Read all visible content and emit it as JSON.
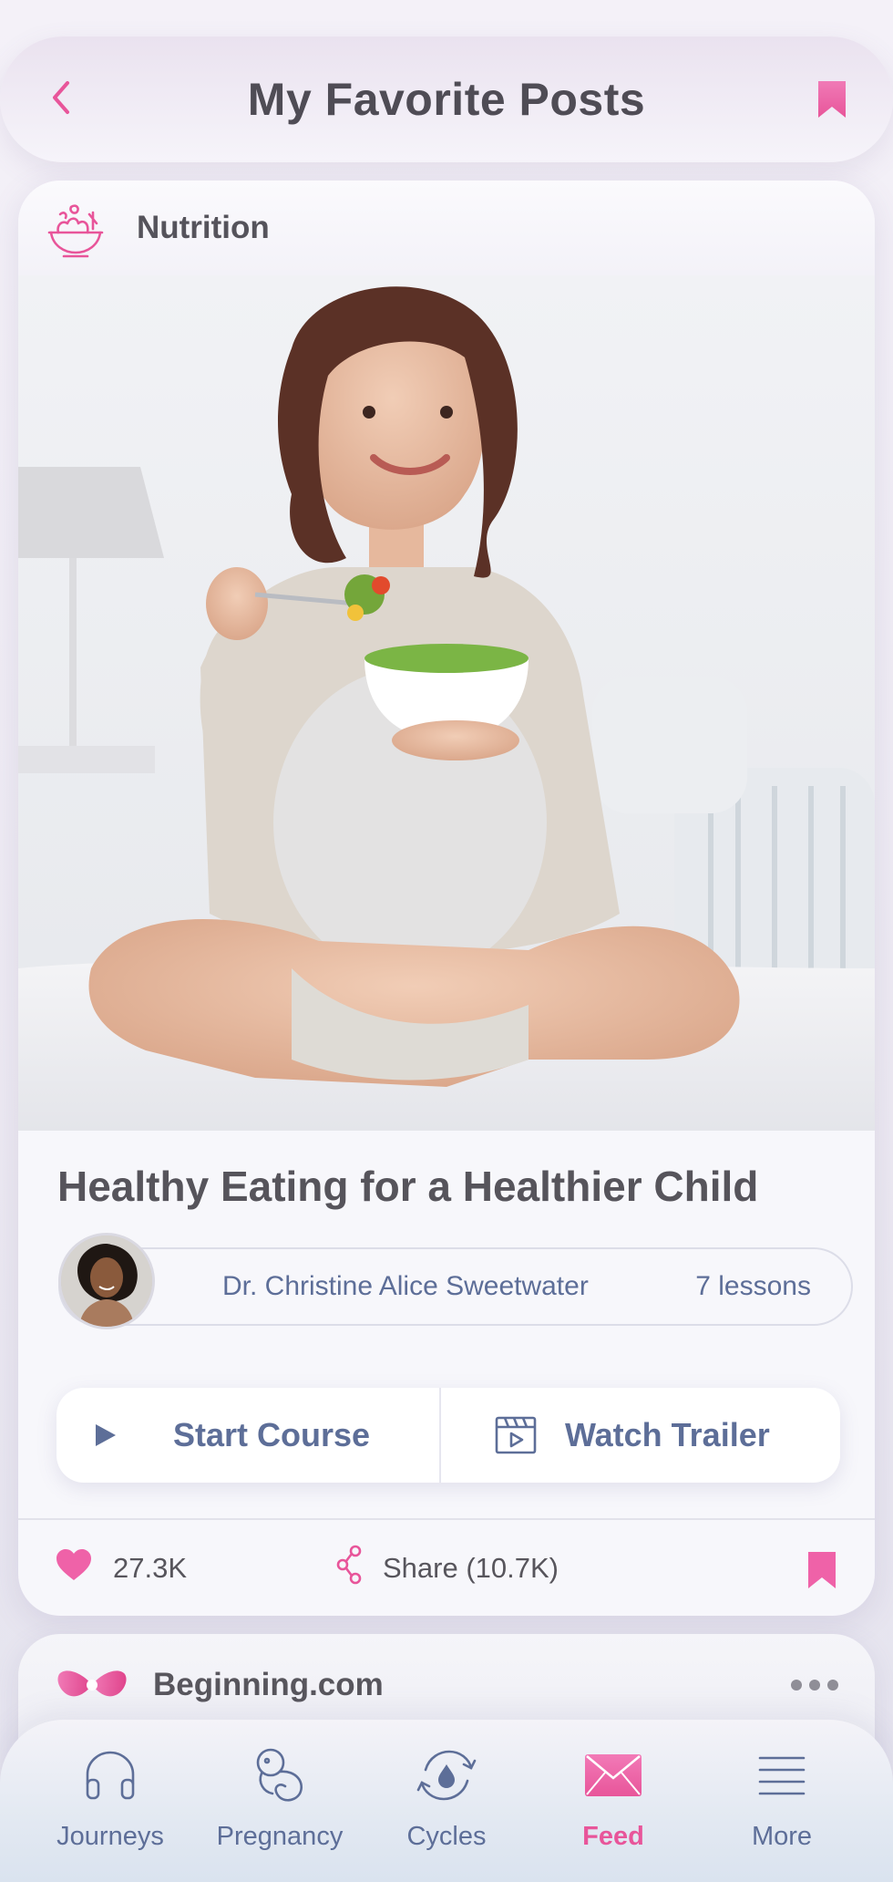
{
  "header": {
    "title": "My Favorite Posts",
    "back_icon": "chevron-left-icon",
    "bookmark_icon": "bookmark-icon"
  },
  "post": {
    "category": "Nutrition",
    "category_icon": "salad-bowl-icon",
    "photo_alt": "photo",
    "title": "Healthy Eating for a Healthier Child",
    "author": {
      "name": "Dr. Christine Alice Sweetwater",
      "lessons": "7 lessons"
    },
    "actions": {
      "start_label": "Start Course",
      "trailer_label": "Watch Trailer"
    },
    "likes": "27.3K",
    "share_label": "Share (10.7K)"
  },
  "next_post": {
    "source": "Beginning.com"
  },
  "tabs": [
    {
      "label": "Journeys",
      "icon": "headphones-icon",
      "active": false
    },
    {
      "label": "Pregnancy",
      "icon": "fetus-icon",
      "active": false
    },
    {
      "label": "Cycles",
      "icon": "cycle-droplet-icon",
      "active": false
    },
    {
      "label": "Feed",
      "icon": "envelope-icon",
      "active": true
    },
    {
      "label": "More",
      "icon": "menu-lines-icon",
      "active": false
    }
  ],
  "colors": {
    "accent_pink": "#e8559a",
    "text_blue": "#5d6e98",
    "text_dark": "#55535b"
  }
}
